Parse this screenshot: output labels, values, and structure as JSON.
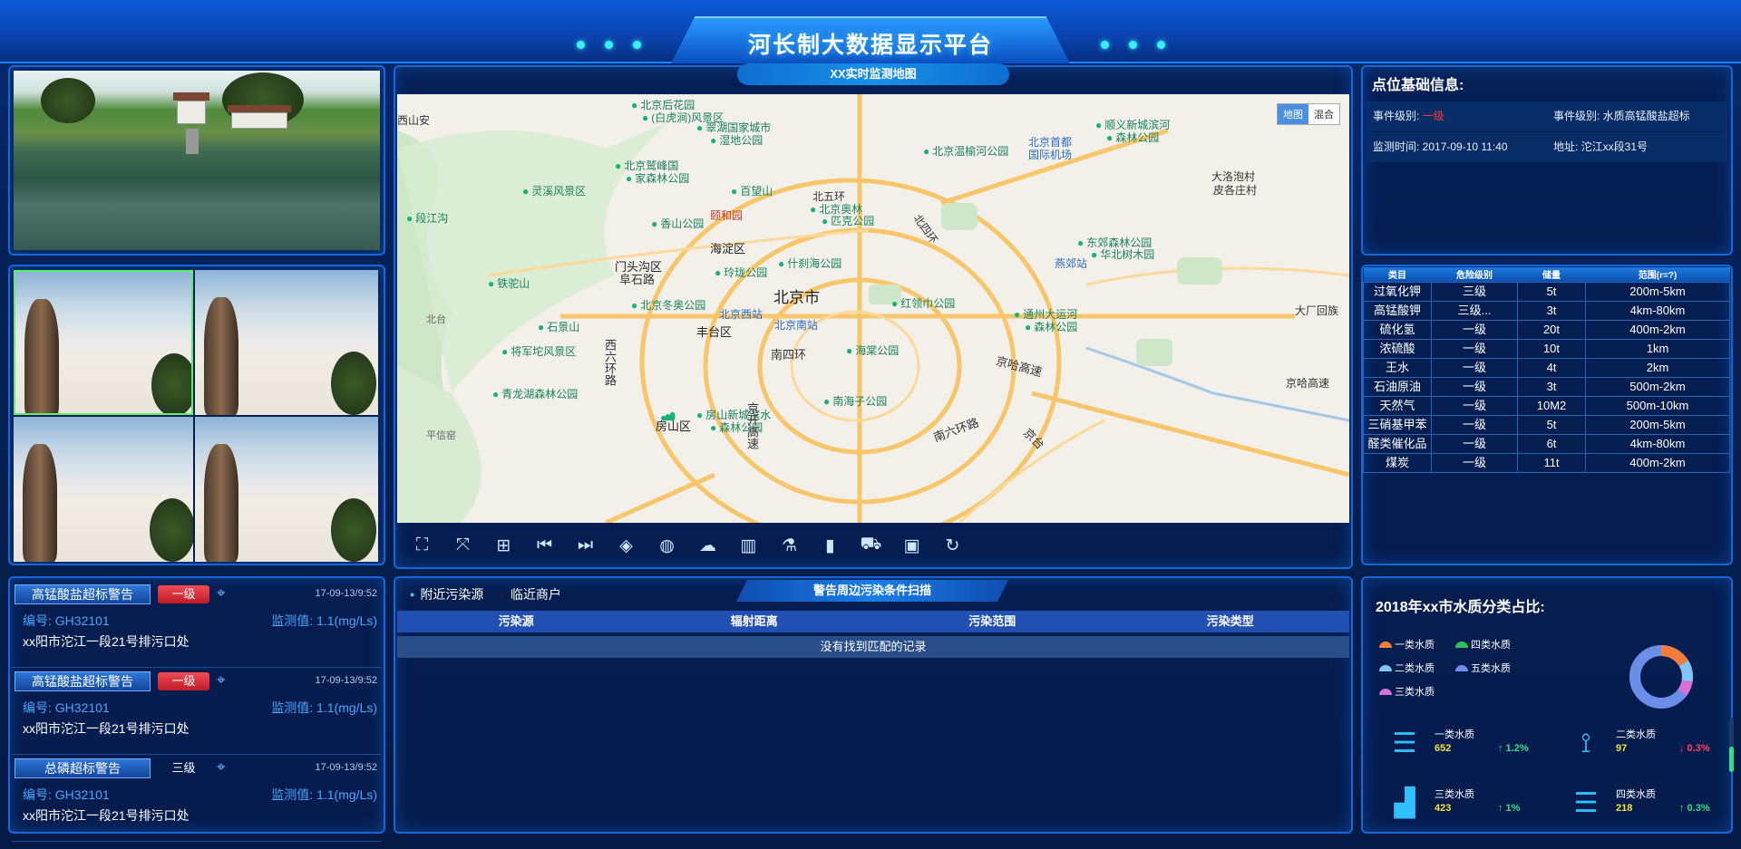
{
  "header": {
    "title": "河长制大数据显示平台"
  },
  "map": {
    "title": "XX实时监测地图",
    "type_map": "地图",
    "type_hybrid": "混合",
    "labels": [
      "北京后花园",
      "(白虎涧)风景区",
      "翠湖国家城市",
      "湿地公园",
      "北京鹫峰国",
      "家森林公园",
      "灵溪风景区",
      "百望山",
      "颐和园",
      "北五环",
      "北京奥林",
      "匹克公园",
      "北京温榆河公园",
      "北京首都",
      "国际机场",
      "顺义新城滨河",
      "森林公园",
      "东郊森林公园",
      "华北树木园",
      "大洛泡村",
      "皮各庄村",
      "北四环",
      "海淀区",
      "香山公园",
      "门头沟区",
      "玲珑公园",
      "什刹海公园",
      "燕郊站",
      "阜石路",
      "北京市",
      "铁驼山",
      "北京冬奥公园",
      "北京西站",
      "北京南站",
      "红领巾公园",
      "通州大运河",
      "森林公园",
      "大厂回族",
      "石景山",
      "西六环路",
      "丰台区",
      "南四环",
      "海棠公园",
      "将军坨风景区",
      "京哈高速",
      "青龙湖森林公园",
      "房山区",
      "房山新城滨水",
      "森林公园",
      "南海子公园",
      "京开高速",
      "南六环路",
      "京台",
      "段江沟",
      "北台",
      "平信窑"
    ]
  },
  "toolbar": {
    "icons": [
      "fullscreen-icon",
      "fit-icon",
      "grid-icon",
      "prev-icon",
      "next-icon",
      "layers-icon",
      "globe-icon",
      "cloud-icon",
      "building-icon",
      "flask-icon",
      "chart-icon",
      "truck-icon",
      "window-icon",
      "refresh-icon"
    ]
  },
  "info": {
    "title": "点位基础信息:",
    "rows": [
      {
        "a": "事件级别: ",
        "a2": "一级",
        "b": "事件级别: 水质高锰酸盐超标"
      },
      {
        "a": "监测时间: 2017-09-10 11:40",
        "b": "地址: 沱江xx段31号"
      }
    ]
  },
  "hazard": {
    "headers": [
      "类目",
      "危险级别",
      "储量",
      "范围(r=?)"
    ],
    "rows": [
      [
        "过氧化钾",
        "三级",
        "5t",
        "200m-5km"
      ],
      [
        "高锰酸钾",
        "三级...",
        "3t",
        "4km-80km"
      ],
      [
        "硫化氢",
        "一级",
        "20t",
        "400m-2km"
      ],
      [
        "浓硫酸",
        "一级",
        "10t",
        "1km"
      ],
      [
        "王水",
        "一级",
        "4t",
        "2km"
      ],
      [
        "石油原油",
        "一级",
        "3t",
        "500m-2km"
      ],
      [
        "天然气",
        "一级",
        "10M2",
        "500m-10km"
      ],
      [
        "三硝基甲苯",
        "一级",
        "5t",
        "200m-5km"
      ],
      [
        "醛类催化品",
        "一级",
        "6t",
        "4km-80km"
      ],
      [
        "煤炭",
        "一级",
        "11t",
        "400m-2km"
      ]
    ]
  },
  "alarms": [
    {
      "title": "高锰酸盐超标警告",
      "level": "一级",
      "time": "17-09-13/9:52",
      "code": "编号:  GH32101",
      "value": "监测值:  1.1(mg/Ls)",
      "address": "xx阳市沱江一段21号排污口处"
    },
    {
      "title": "高锰酸盐超标警告",
      "level": "一级",
      "time": "17-09-13/9:52",
      "code": "编号:  GH32101",
      "value": "监测值:  1.1(mg/Ls)",
      "address": "xx阳市沱江一段21号排污口处"
    },
    {
      "title": "总磷超标警告",
      "level": "三级",
      "time": "17-09-13/9:52",
      "code": "编号:  GH32101",
      "value": "监测值:  1.1(mg/Ls)",
      "address": "xx阳市沱江一段21号排污口处"
    }
  ],
  "scan": {
    "tab1": "附近污染源",
    "tab2": "临近商户",
    "title": "警告周边污染条件扫描",
    "headers": [
      "污染源",
      "辐射距离",
      "污染范围",
      "污染类型"
    ],
    "empty": "没有找到匹配的记录"
  },
  "quality": {
    "title": "2018年xx市水质分类占比:",
    "legend": [
      {
        "name": "一类水质",
        "color": "#f07d3b"
      },
      {
        "name": "四类水质",
        "color": "#2ec25a"
      },
      {
        "name": "二类水质",
        "color": "#7fc6f5"
      },
      {
        "name": "五类水质",
        "color": "#6b8fe8"
      },
      {
        "name": "三类水质",
        "color": "#d66fd6"
      }
    ],
    "stats": [
      {
        "name": "一类水质",
        "value": "652",
        "change": "↑ 1.2%",
        "dir": "up",
        "icon": "layers-stack-icon"
      },
      {
        "name": "二类水质",
        "value": "97",
        "change": "↓ 0.3%",
        "dir": "down",
        "icon": "network-icon"
      },
      {
        "name": "三类水质",
        "value": "423",
        "change": "↑ 1%",
        "dir": "up",
        "icon": "bar-trend-icon"
      },
      {
        "name": "四类水质",
        "value": "218",
        "change": "↑ 0.3%",
        "dir": "up",
        "icon": "layers-stack-icon"
      }
    ]
  }
}
